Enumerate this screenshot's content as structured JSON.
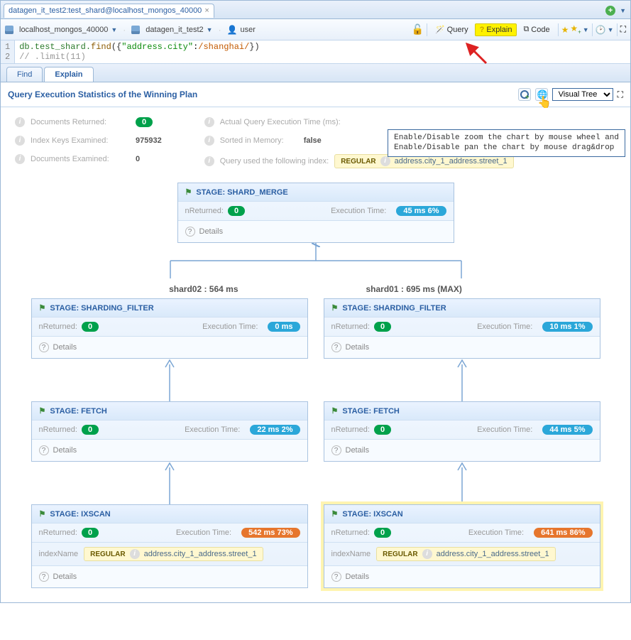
{
  "tab": {
    "label": "datagen_it_test2:test_shard@localhost_mongos_40000",
    "close": "×"
  },
  "toolbar": {
    "connection": "localhost_mongos_40000",
    "database": "datagen_it_test2",
    "user": "user",
    "buttons": {
      "query": "Query",
      "explain": "Explain",
      "code": "Code"
    }
  },
  "code": {
    "line1_num": "1",
    "line2_num": "2",
    "db": "db",
    "coll": ".test_shard.",
    "find": "find",
    "open": "({",
    "key": "\"address.city\"",
    "colon": ":",
    "regex": "/shanghai/",
    "close": "})",
    "comment": "//   .limit(11)"
  },
  "subtabs": {
    "find": "Find",
    "explain": "Explain"
  },
  "panel": {
    "title": "Query Execution Statistics of the Winning Plan",
    "view": "Visual Tree"
  },
  "tooltip": {
    "l1": "Enable/Disable zoom the chart by mouse wheel and",
    "l2": "Enable/Disable pan the chart by mouse drag&drop"
  },
  "stats": {
    "docsReturned": {
      "label": "Documents Returned:",
      "value": "0"
    },
    "indexKeys": {
      "label": "Index Keys Examined:",
      "value": "975932"
    },
    "docsExamined": {
      "label": "Documents Examined:",
      "value": "0"
    },
    "execTime": {
      "label": "Actual Query Execution Time (ms):"
    },
    "sorted": {
      "label": "Sorted in Memory:",
      "value": "false"
    },
    "indexUsed": {
      "label": "Query used the following index:",
      "regular": "REGULAR",
      "name": "address.city_1_address.street_1"
    }
  },
  "tree": {
    "shardMerge": {
      "title": "STAGE: SHARD_MERGE",
      "nRetLabel": "nReturned:",
      "nRet": "0",
      "execLabel": "Execution Time:",
      "exec": "45 ms  6%",
      "details": "Details"
    },
    "shards": {
      "left": "shard02 : 564 ms",
      "right": "shard01 : 695 ms (MAX)"
    },
    "shardFilterL": {
      "title": "STAGE: SHARDING_FILTER",
      "nRetLabel": "nReturned:",
      "nRet": "0",
      "execLabel": "Execution Time:",
      "exec": "0 ms",
      "details": "Details"
    },
    "shardFilterR": {
      "title": "STAGE: SHARDING_FILTER",
      "nRetLabel": "nReturned:",
      "nRet": "0",
      "execLabel": "Execution Time:",
      "exec": "10 ms  1%",
      "details": "Details"
    },
    "fetchL": {
      "title": "STAGE: FETCH",
      "nRetLabel": "nReturned:",
      "nRet": "0",
      "execLabel": "Execution Time:",
      "exec": "22 ms  2%",
      "details": "Details"
    },
    "fetchR": {
      "title": "STAGE: FETCH",
      "nRetLabel": "nReturned:",
      "nRet": "0",
      "execLabel": "Execution Time:",
      "exec": "44 ms  5%",
      "details": "Details"
    },
    "ixscanL": {
      "title": "STAGE: IXSCAN",
      "nRetLabel": "nReturned:",
      "nRet": "0",
      "execLabel": "Execution Time:",
      "exec": "542 ms  73%",
      "indexLabel": "indexName",
      "regular": "REGULAR",
      "indexName": "address.city_1_address.street_1",
      "details": "Details"
    },
    "ixscanR": {
      "title": "STAGE: IXSCAN",
      "nRetLabel": "nReturned:",
      "nRet": "0",
      "execLabel": "Execution Time:",
      "exec": "641 ms  86%",
      "indexLabel": "indexName",
      "regular": "REGULAR",
      "indexName": "address.city_1_address.street_1",
      "details": "Details"
    }
  }
}
